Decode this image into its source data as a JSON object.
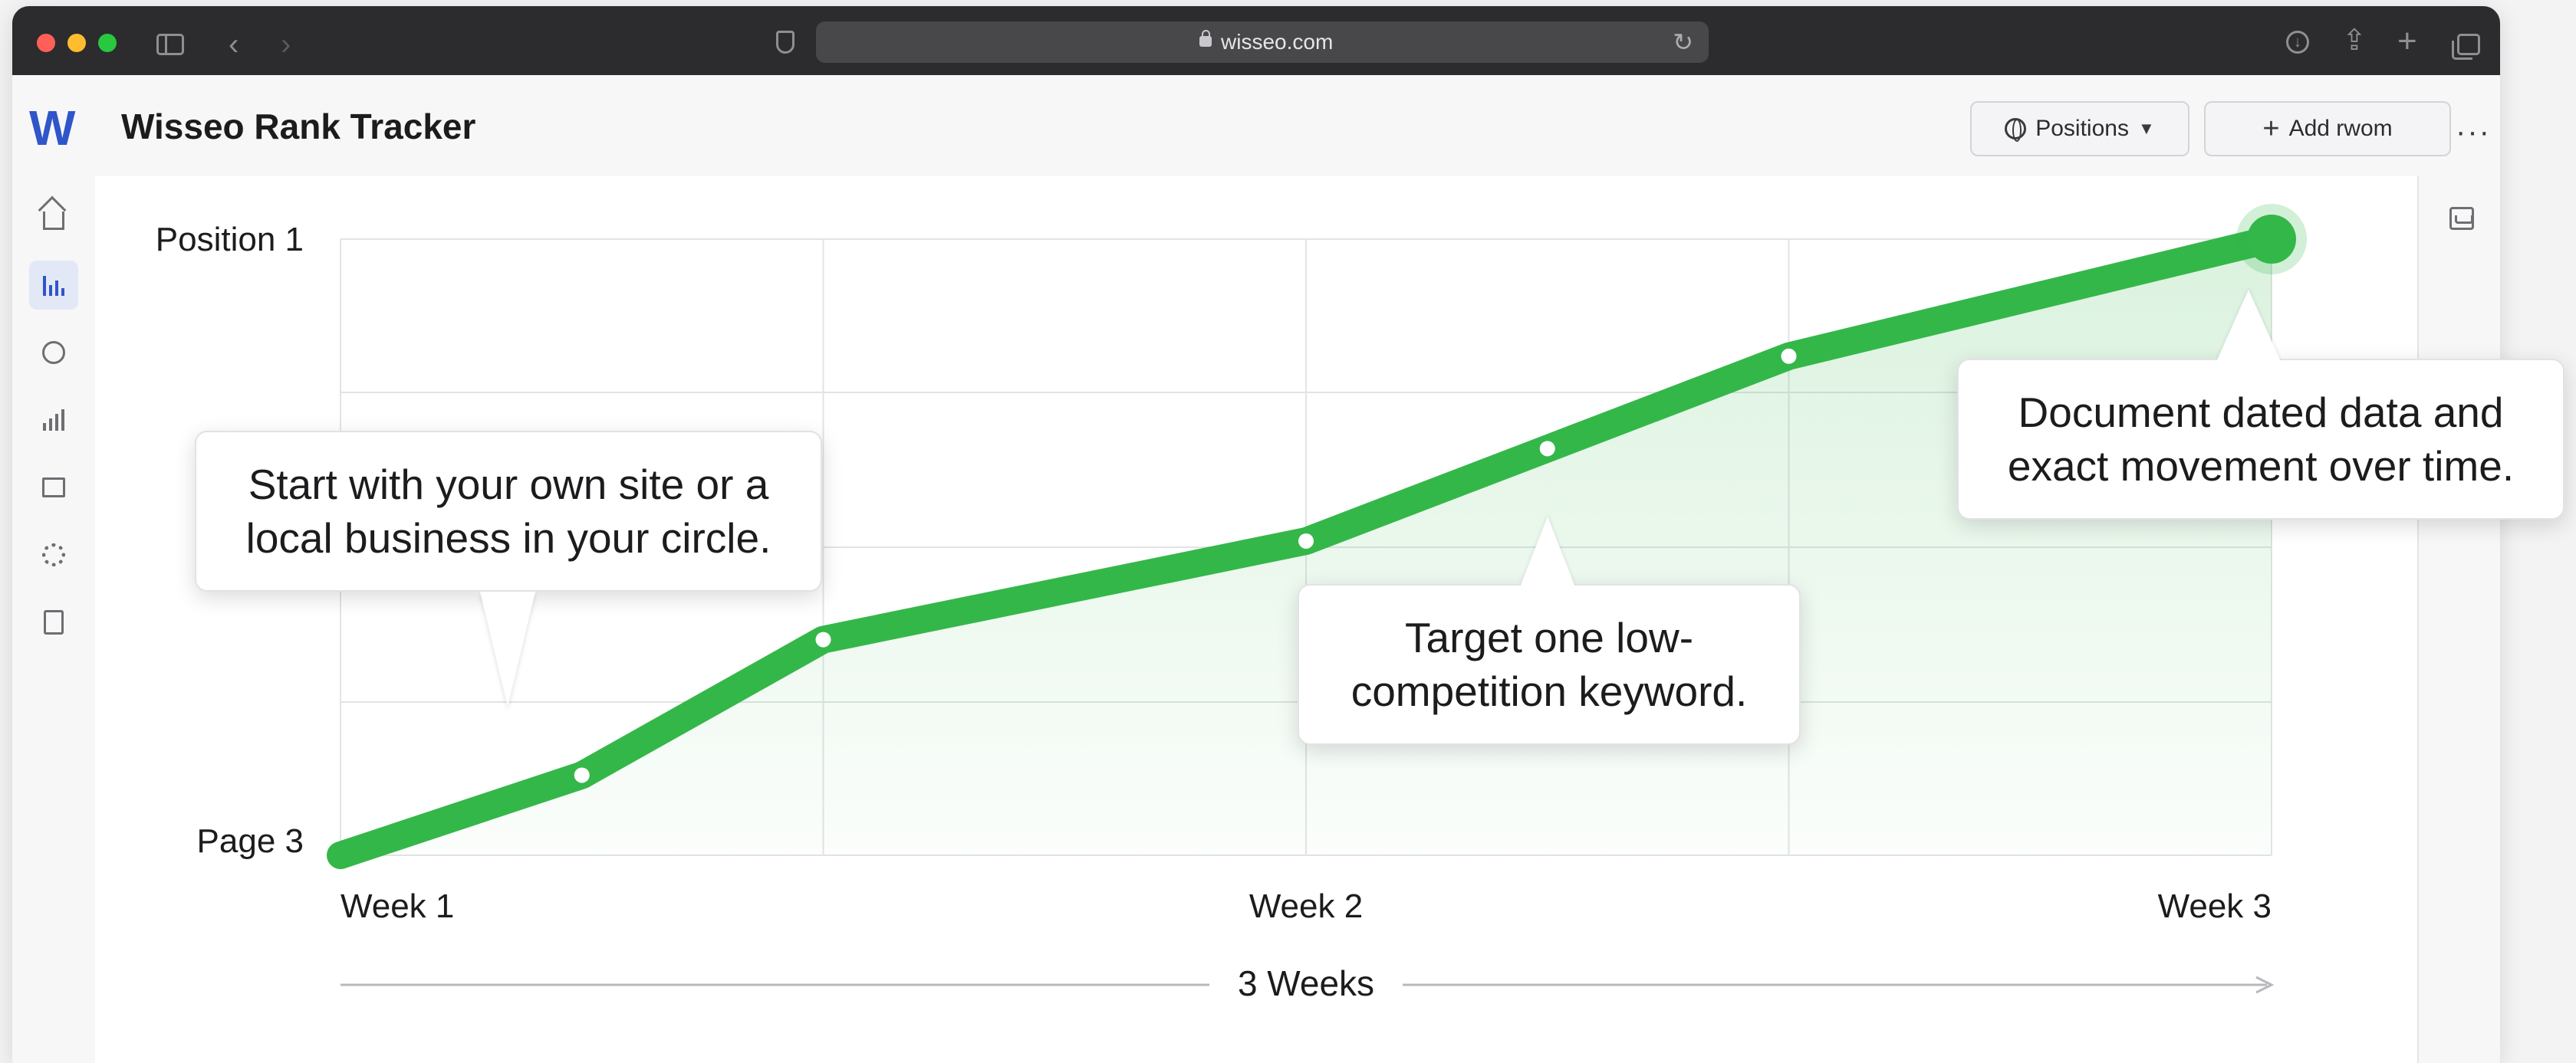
{
  "browser": {
    "url": "wisseo.com"
  },
  "app": {
    "logo_letter": "W",
    "title": "Wisseo Rank Tracker",
    "positions_button": "Positions",
    "add_button": "Add rwom",
    "more_label": "···"
  },
  "sidebar": {
    "items": [
      {
        "icon": "home-icon"
      },
      {
        "icon": "rank-chart-icon",
        "active": true
      },
      {
        "icon": "check-circle-icon"
      },
      {
        "icon": "bar-chart-icon"
      },
      {
        "icon": "flag-icon"
      },
      {
        "icon": "gear-icon"
      },
      {
        "icon": "report-icon"
      }
    ]
  },
  "colors": {
    "accent": "#2f55c9",
    "line": "#34b749"
  },
  "chart_data": {
    "type": "line",
    "y_ticks": [
      "Position 1",
      "Page 3"
    ],
    "x_ticks": [
      "Week 1",
      "Week 2",
      "Week 3"
    ],
    "duration_label": "3 Weeks",
    "series": [
      {
        "x": [
          1,
          1.25,
          1.5,
          2,
          2.25,
          2.5,
          3
        ],
        "y": [
          0,
          0.13,
          0.35,
          0.51,
          0.66,
          0.81,
          1.0
        ]
      }
    ],
    "y_range": [
      "Page 3",
      "Position 1"
    ],
    "grid": true,
    "annotations": [
      {
        "text": "Start with your own site or a local business in your circle."
      },
      {
        "text": "Target one low-competition keyword."
      },
      {
        "text": "Document dated data and exact movement over time."
      }
    ]
  }
}
